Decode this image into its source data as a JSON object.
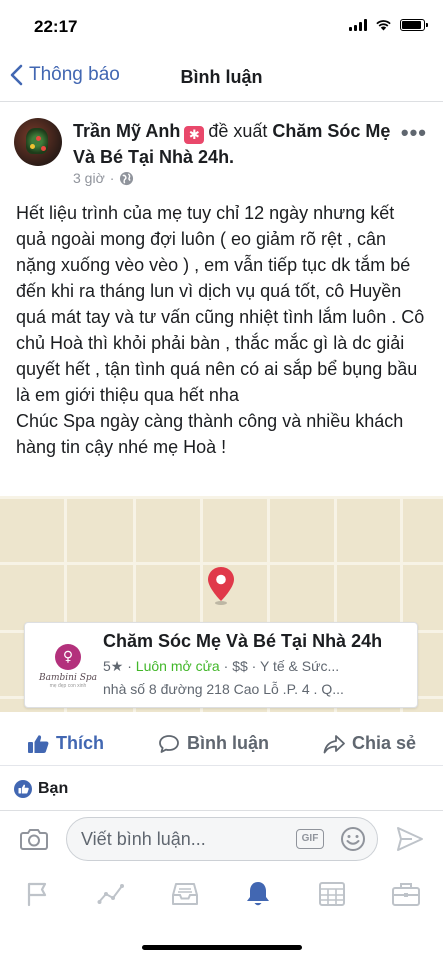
{
  "status": {
    "time": "22:17"
  },
  "nav": {
    "back_label": "Thông báo",
    "title": "Bình luận"
  },
  "post": {
    "author": "Trần Mỹ Anh",
    "action_text": "đề xuất",
    "page_name": "Chăm Sóc Mẹ Và Bé Tại Nhà 24h.",
    "time": "3 giờ",
    "more": "•••",
    "body_paragraphs": [
      "Hết liệu trình của mẹ tuy chỉ 12 ngày nhưng kết quả ngoài mong đợi luôn ( eo giảm rõ rệt , cân nặng xuống vèo vèo ) , em vẫn tiếp tục dk tắm bé đến khi ra tháng lun vì dịch vụ quá tốt, cô Huyền quá mát tay và tư vấn cũng nhiệt tình lắm luôn . Cô chủ Hoà thì khỏi phải bàn , thắc mắc gì là dc giải quyết hết , tận tình quá nên có ai sắp bể bụng bầu là em giới thiệu qua hết nha",
      "Chúc Spa ngày càng thành công và nhiều khách hàng tin cậy nhé mẹ Hoà !"
    ]
  },
  "place": {
    "name": "Chăm Sóc Mẹ Và Bé Tại Nhà 24h",
    "rating": "5★",
    "separator": " · ",
    "open_status": "Luôn mở cửa",
    "price": "$$",
    "category": "Y tế & Sức...",
    "address": "nhà số 8 đường 218 Cao Lỗ .P. 4 . Q...",
    "logo_text": "Bambini Spa",
    "logo_sub": "mẹ đẹp con xinh"
  },
  "actions": {
    "like": "Thích",
    "comment": "Bình luận",
    "share": "Chia sẻ"
  },
  "reactions": {
    "label": "Bạn"
  },
  "composer": {
    "placeholder": "Viết bình luận...",
    "gif": "GIF"
  },
  "colors": {
    "brand_blue": "#4267b2",
    "open_green": "#42b72a",
    "recommend_badge": "#e9486b",
    "map_pin": "#e0394a",
    "map_bg": "#ede5cd"
  }
}
